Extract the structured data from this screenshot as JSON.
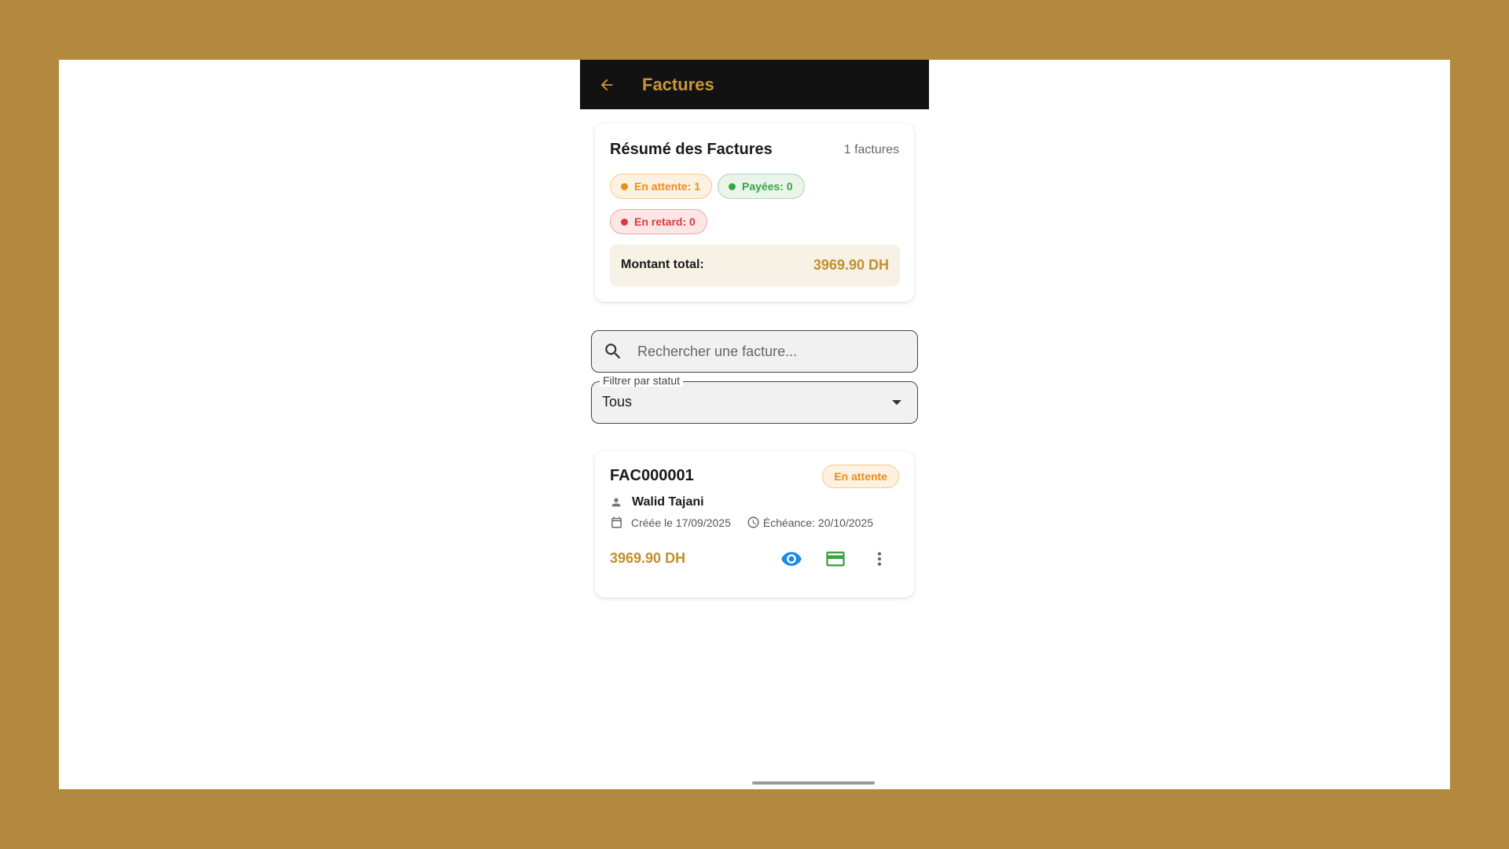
{
  "appbar": {
    "title": "Factures",
    "back_icon": "arrow-left-icon",
    "accent": "#c9963a"
  },
  "summary": {
    "title": "Résumé des Factures",
    "count": "1 factures",
    "chips": {
      "pending": "En attente: 1",
      "paid": "Payées: 0",
      "late": "En retard: 0"
    },
    "total_label": "Montant total:",
    "total_value": "3969.90 DH"
  },
  "search": {
    "placeholder": "Rechercher une facture...",
    "value": ""
  },
  "filter": {
    "label": "Filtrer par statut",
    "value": "Tous"
  },
  "invoices": [
    {
      "number": "FAC000001",
      "status": "En attente",
      "client": "Walid Tajani",
      "created": "Créée le 17/09/2025",
      "due": "Échéance: 20/10/2025",
      "amount": "3969.90 DH"
    }
  ],
  "colors": {
    "background": "#b38940",
    "pending": "#ec8f13",
    "paid": "#3ea245",
    "late": "#db3a3a",
    "amount": "#c0902f",
    "view_icon": "#1e88e5",
    "pay_icon": "#43a047"
  }
}
